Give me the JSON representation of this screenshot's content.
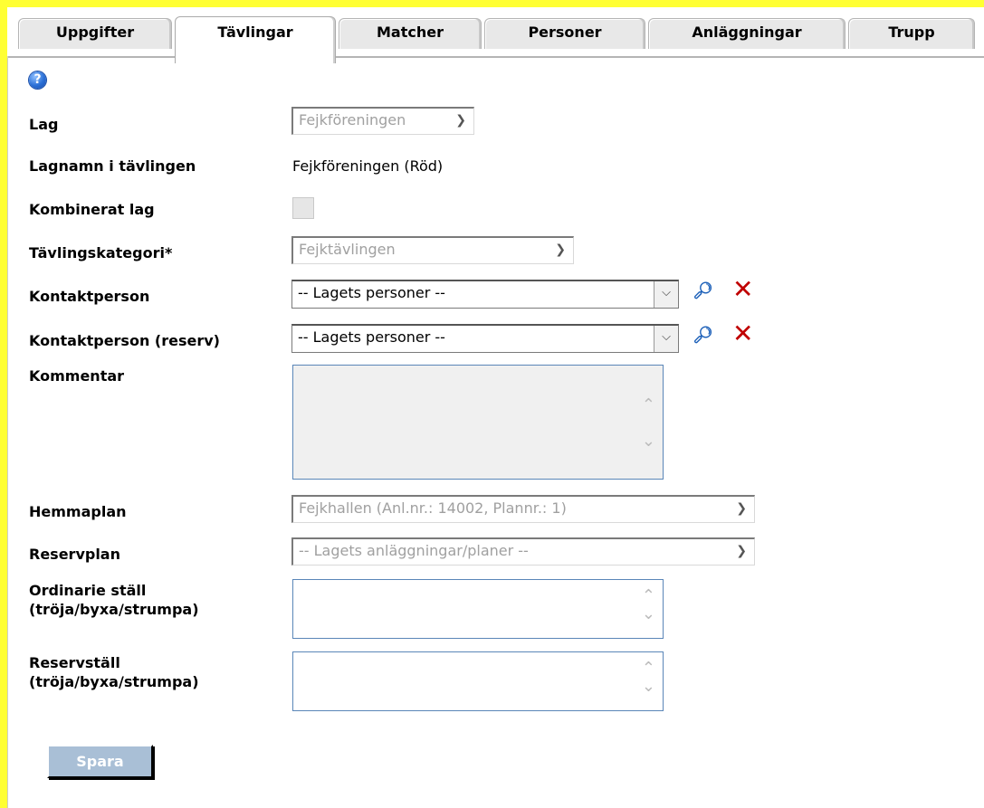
{
  "tabs": [
    "Uppgifter",
    "Tävlingar",
    "Matcher",
    "Personer",
    "Anläggningar",
    "Trupp"
  ],
  "form": {
    "help_symbol": "?",
    "lag": {
      "label": "Lag",
      "value": "Fejkföreningen"
    },
    "lagnamn": {
      "label": "Lagnamn i tävlingen",
      "value": "Fejkföreningen (Röd)"
    },
    "kombinerat": {
      "label": "Kombinerat lag"
    },
    "kategori": {
      "label": "Tävlingskategori*",
      "value": "Fejktävlingen"
    },
    "kontakt": {
      "label": "Kontaktperson",
      "value": "-- Lagets personer --"
    },
    "kontakt_reserv": {
      "label": "Kontaktperson (reserv)",
      "value": "-- Lagets personer --"
    },
    "kommentar": {
      "label": "Kommentar"
    },
    "hemmaplan": {
      "label": "Hemmaplan",
      "value": "Fejkhallen (Anl.nr.: 14002, Plannr.: 1)"
    },
    "reservplan": {
      "label": "Reservplan",
      "value": "-- Lagets anläggningar/planer --"
    },
    "ordinarie": {
      "label_line1": "Ordinarie ställ",
      "label_line2": "(tröja/byxa/strumpa)"
    },
    "reservstall": {
      "label_line1": "Reservställ",
      "label_line2": "(tröja/byxa/strumpa)"
    }
  },
  "save_label": "Spara",
  "colors": {
    "frame": "#ffff33",
    "delete": "#c00000",
    "search": "#1b5fb8",
    "save_button": "#a9bfd6"
  }
}
